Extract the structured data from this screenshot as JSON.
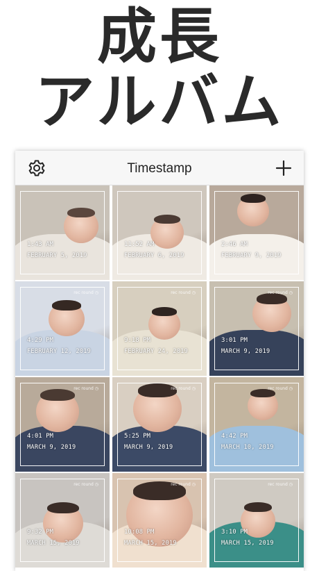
{
  "headline": {
    "line1": "成長",
    "line2": "アルバム"
  },
  "nav": {
    "title": "Timestamp",
    "left_icon": "gear-icon",
    "right_icon": "plus-icon"
  },
  "photos": [
    {
      "time": "1:43 AM",
      "date": "FEBRUARY 5, 2019",
      "logo": "",
      "bg": "#c9c2b8",
      "blanket": "#e9e4dd",
      "hair": "#5a463d"
    },
    {
      "time": "11:52 AM",
      "date": "FEBRUARY 6, 2019",
      "logo": "",
      "bg": "#cfc7bd",
      "blanket": "#efeae3",
      "hair": "#4b3a33"
    },
    {
      "time": "2:46 AM",
      "date": "FEBRUARY 9, 2019",
      "logo": "",
      "bg": "#b8a99b",
      "blanket": "#f4f0ea",
      "hair": "#2e2320"
    },
    {
      "time": "4:29 PM",
      "date": "FEBRUARY 12, 2019",
      "logo": "rec round ◷",
      "bg": "#d8dde6",
      "blanket": "#c9d4e3",
      "hair": "#352823"
    },
    {
      "time": "9:18 PM",
      "date": "FEBRUARY 24, 2019",
      "logo": "rec round ◷",
      "bg": "#d7cfbf",
      "blanket": "#e8e2d3",
      "hair": "#2e2420"
    },
    {
      "time": "3:01 PM",
      "date": "MARCH 9, 2019",
      "logo": "rec round ◷",
      "bg": "#c7bfb0",
      "blanket": "#36425a",
      "hair": "#3a2c27"
    },
    {
      "time": "4:01 PM",
      "date": "MARCH 9, 2019",
      "logo": "rec round ◷",
      "bg": "#b8aa9a",
      "blanket": "#3a4660",
      "hair": "#4a3a32"
    },
    {
      "time": "5:25 PM",
      "date": "MARCH 9, 2019",
      "logo": "rec round ◷",
      "bg": "#d9cfc2",
      "blanket": "#3c4a66",
      "hair": "#3a2c27"
    },
    {
      "time": "4:42 PM",
      "date": "MARCH 10, 2019",
      "logo": "rec round ◷",
      "bg": "#c3b59f",
      "blanket": "#9fc0dd",
      "hair": "#3a2c27"
    },
    {
      "time": "9:32 PM",
      "date": "MARCH 15, 2019",
      "logo": "rec round ◷",
      "bg": "#c8c4c0",
      "blanket": "#dedbd6",
      "hair": "#3a2c27"
    },
    {
      "time": "10:08 PM",
      "date": "MARCH 15, 2019",
      "logo": "rec round ◷",
      "bg": "#d8c3b0",
      "blanket": "#f0e0cf",
      "hair": "#3a2c27"
    },
    {
      "time": "3:10 PM",
      "date": "MARCH 15, 2019",
      "logo": "rec round ◷",
      "bg": "#cfcac2",
      "blanket": "#3b8f88",
      "hair": "#3a2c27"
    }
  ]
}
